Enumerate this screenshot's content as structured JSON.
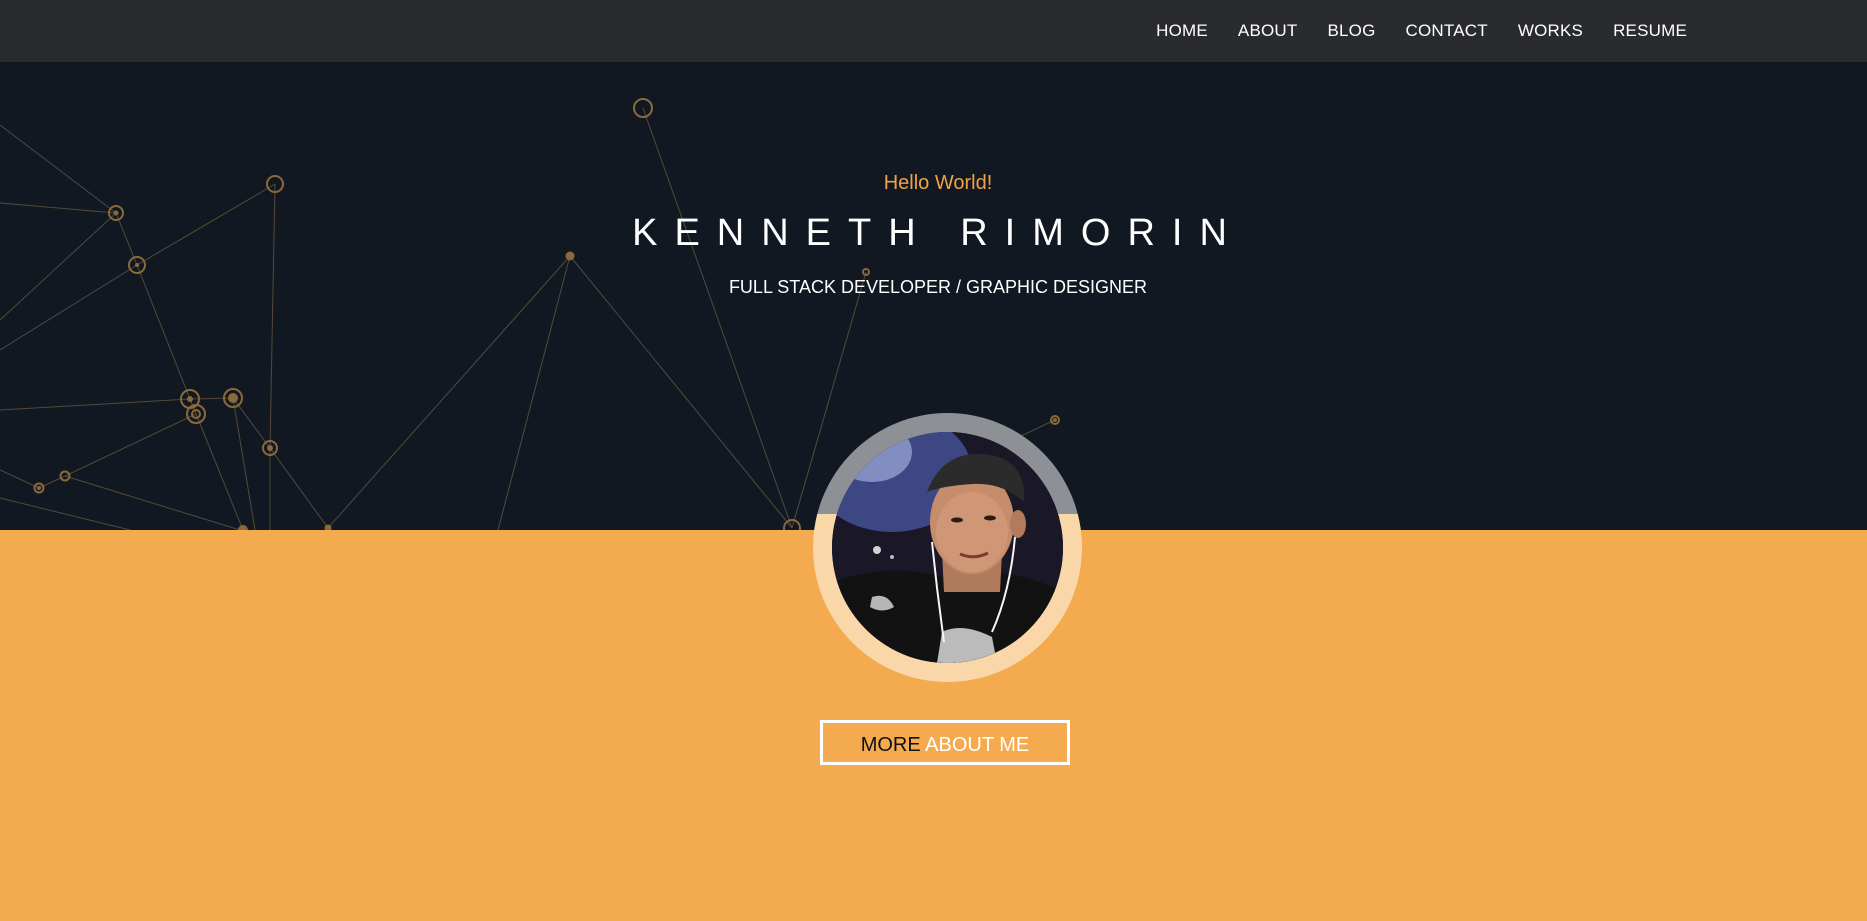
{
  "nav": {
    "items": [
      {
        "label": "HOME"
      },
      {
        "label": "ABOUT"
      },
      {
        "label": "BLOG"
      },
      {
        "label": "CONTACT"
      },
      {
        "label": "WORKS"
      },
      {
        "label": "RESUME"
      }
    ]
  },
  "hero": {
    "greeting": "Hello World!",
    "name": "KENNETH RIMORIN",
    "role": "FULL STACK DEVELOPER / GRAPHIC DESIGNER"
  },
  "cta": {
    "first_word": "MORE",
    "rest": "ABOUT ME"
  },
  "colors": {
    "accent": "#f4aa4e",
    "hero_bg": "#111821",
    "navbar_bg": "#292b2f",
    "greeting": "#f0a346"
  }
}
